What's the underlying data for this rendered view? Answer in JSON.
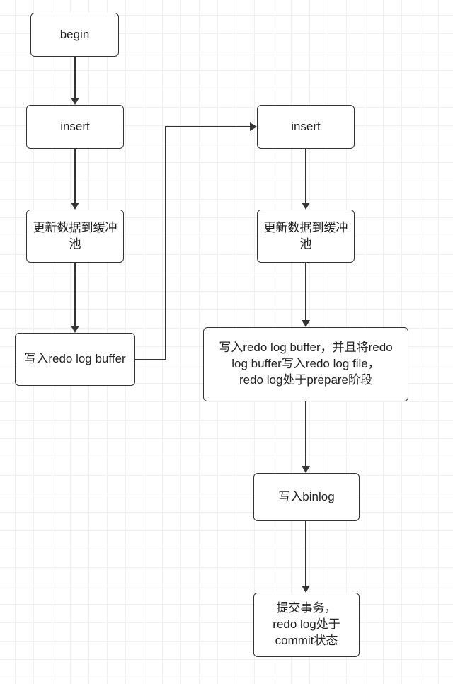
{
  "nodes": {
    "begin": "begin",
    "insert1": "insert",
    "update1": "更新数据到缓冲池",
    "redo1": "写入redo log buffer",
    "insert2": "insert",
    "update2": "更新数据到缓冲池",
    "redo2": "写入redo log buffer，并且将redo log buffer写入redo log file，\nredo log处于prepare阶段",
    "binlog": "写入binlog",
    "commit": "提交事务，\nredo log处于commit状态"
  }
}
